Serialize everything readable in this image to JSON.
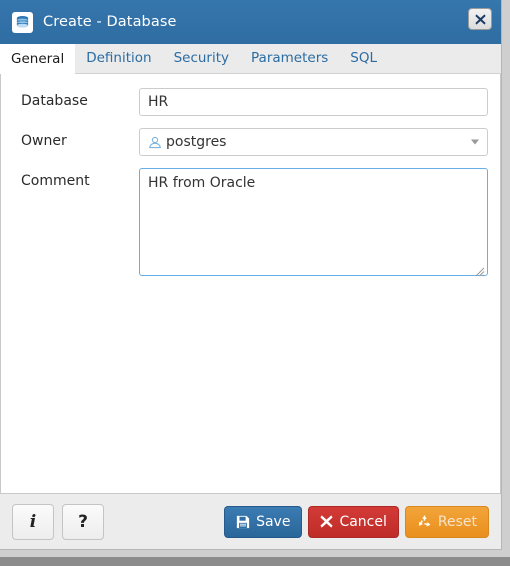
{
  "window": {
    "title": "Create - Database",
    "icon": "database-icon",
    "close_label": "✖"
  },
  "tabs": [
    {
      "label": "General",
      "active": true
    },
    {
      "label": "Definition",
      "active": false
    },
    {
      "label": "Security",
      "active": false
    },
    {
      "label": "Parameters",
      "active": false
    },
    {
      "label": "SQL",
      "active": false
    }
  ],
  "form": {
    "database": {
      "label": "Database",
      "value": "HR",
      "placeholder": ""
    },
    "owner": {
      "label": "Owner",
      "value": "postgres",
      "icon": "user-icon"
    },
    "comment": {
      "label": "Comment",
      "value": "HR from Oracle",
      "placeholder": "",
      "focused": true
    }
  },
  "footer": {
    "info_label": "i",
    "help_label": "?",
    "save_label": "Save",
    "cancel_label": "Cancel",
    "reset_label": "Reset"
  },
  "colors": {
    "titlebar": "#3272a8",
    "tab_link": "#2b6ca3",
    "focus_border": "#66afe9",
    "save": "#2f6fa5",
    "cancel": "#c9302c",
    "reset": "#ef9a2a"
  }
}
